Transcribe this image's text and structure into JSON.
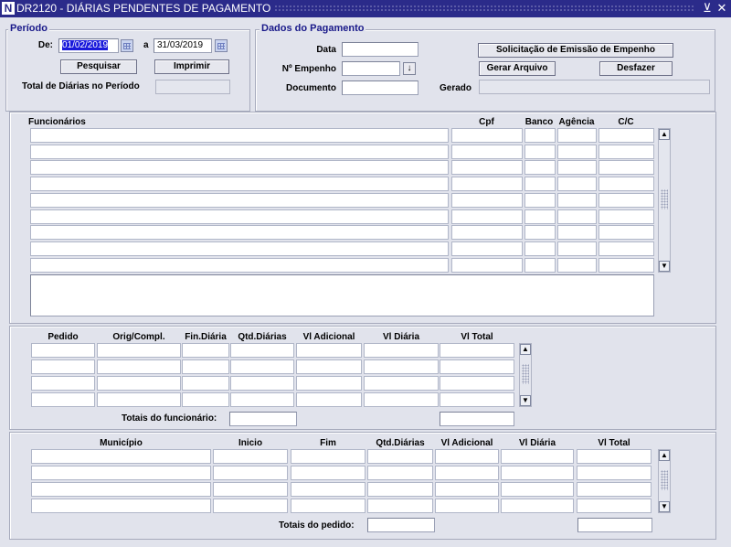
{
  "window": {
    "title": "DR2120 - DIÁRIAS PENDENTES DE PAGAMENTO",
    "minimize_glyph": "⊻",
    "close_glyph": "✕"
  },
  "periodo": {
    "legend": "Período",
    "de_label": "De:",
    "de_value": "01/02/2019",
    "a_label": "a",
    "ate_value": "31/03/2019",
    "pesquisar_label": "Pesquisar",
    "imprimir_label": "Imprimir",
    "total_label": "Total de Diárias no Período",
    "total_value": ""
  },
  "pagamento": {
    "legend": "Dados do Pagamento",
    "data_label": "Data",
    "empenho_label": "Nº Empenho",
    "documento_label": "Documento",
    "gerado_label": "Gerado",
    "solicitacao_label": "Solicitação de Emissão de Empenho",
    "gerar_label": "Gerar Arquivo",
    "desfazer_label": "Desfazer"
  },
  "funcionarios": {
    "headers": {
      "nome": "Funcionários",
      "cpf": "Cpf",
      "banco": "Banco",
      "agencia": "Agência",
      "cc": "C/C"
    }
  },
  "pedidos": {
    "headers": [
      "Pedido",
      "Orig/Compl.",
      "Fin.Diária",
      "Qtd.Diárias",
      "Vl Adicional",
      "Vl Diária",
      "Vl Total"
    ],
    "totais_label": "Totais do funcionário:"
  },
  "municipios": {
    "headers": [
      "Município",
      "Inicio",
      "Fim",
      "Qtd.Diárias",
      "Vl Adicional",
      "Vl Diária",
      "Vl Total"
    ],
    "totais_label": "Totais do pedido:"
  }
}
